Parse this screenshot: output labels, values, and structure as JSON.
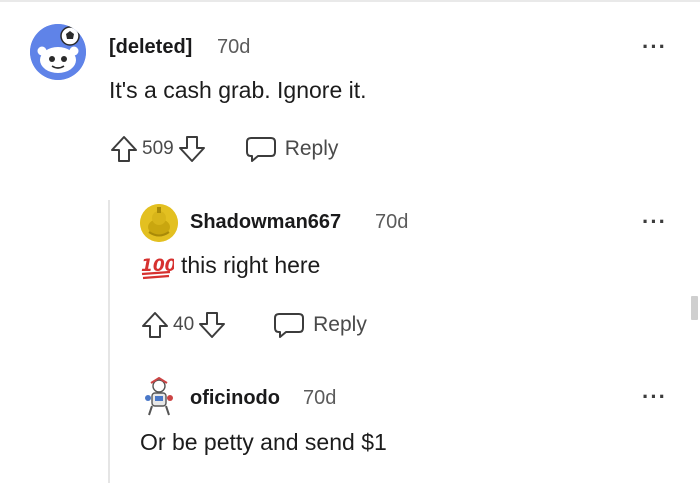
{
  "comments": [
    {
      "author": "[deleted]",
      "time": "70d",
      "body": "It's a cash grab. Ignore it.",
      "score": "509",
      "reply_label": "Reply"
    },
    {
      "author": "Shadowman667",
      "time": "70d",
      "emoji": "100",
      "body": "this right here",
      "score": "40",
      "reply_label": "Reply"
    },
    {
      "author": "oficinodo",
      "time": "70d",
      "body": "Or be petty and send $1"
    }
  ],
  "more_glyph": "···",
  "colors": {
    "text": "#1c1c1c",
    "muted": "#5b5b5b",
    "thread_line": "#e5e5e5",
    "avatar_blue": "#5f83e8",
    "avatar_gold": "#e3c021",
    "hundred_red": "#d6312f"
  }
}
